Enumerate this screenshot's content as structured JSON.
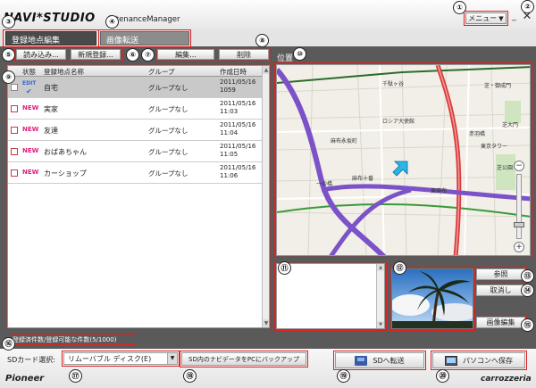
{
  "app": {
    "logo": "NAVI*STUDIO",
    "subtitle": "intenanceManager",
    "menu_label": "メニュー",
    "minimize_glyph": "_",
    "close_glyph": "✕"
  },
  "tabs": [
    {
      "label": "登録地点編集"
    },
    {
      "label": "画像転送"
    }
  ],
  "toolbar": {
    "load_label": "読み込み...",
    "new_label": "新規登録...",
    "edit_label": "編集...",
    "delete_label": "削除"
  },
  "list": {
    "columns": [
      "状態",
      "登録地点名称",
      "グループ",
      "作成日時"
    ],
    "rows": [
      {
        "status": "EDIT",
        "name": "自宅",
        "group": "グループなし",
        "date": "2011/05/16\n1059"
      },
      {
        "status": "NEW",
        "name": "実家",
        "group": "グループなし",
        "date": "2011/05/16\n11:03"
      },
      {
        "status": "NEW",
        "name": "友達",
        "group": "グループなし",
        "date": "2011/05/16\n11:04"
      },
      {
        "status": "NEW",
        "name": "おばあちゃん",
        "group": "グループなし",
        "date": "2011/05/16\n11:05"
      },
      {
        "status": "NEW",
        "name": "カーショップ",
        "group": "グループなし",
        "date": "2011/05/16\n11:06"
      }
    ]
  },
  "count_text": "登録済件数/登録可能な件数(5/1000)",
  "location_label": "位置",
  "map": {
    "labels": [
      "千駄ヶ谷",
      "ロシア大使館",
      "麻布永坂町",
      "東京タワー",
      "赤羽橋",
      "芝・御成門",
      "芝公園",
      "東麻布",
      "麻布十番",
      "一の橋",
      "芝大門"
    ],
    "accent_route": "#7b52c8",
    "accent_highway": "#d83c3c"
  },
  "side_buttons": {
    "browse_label": "参照",
    "cancel_label": "取消し",
    "image_edit_label": "画像編集"
  },
  "bottom": {
    "sd_label": "SDカード選択:",
    "sd_value": "リムーバブル ディスク(E)",
    "backup_label": "SD内のナビデータをPCにバックアップ",
    "sd_transfer_label": "SDへ転送",
    "pc_save_label": "パソコンへ保存",
    "pioneer": "Pioneer",
    "carrozzeria": "carrozzeria"
  },
  "markers": [
    "①",
    "②",
    "③",
    "④",
    "⑤",
    "⑥",
    "⑦",
    "⑧",
    "⑨",
    "⑩",
    "⑪",
    "⑫",
    "⑬",
    "⑭",
    "⑮",
    "⑯",
    "⑰",
    "⑱",
    "⑲",
    "⑳"
  ]
}
